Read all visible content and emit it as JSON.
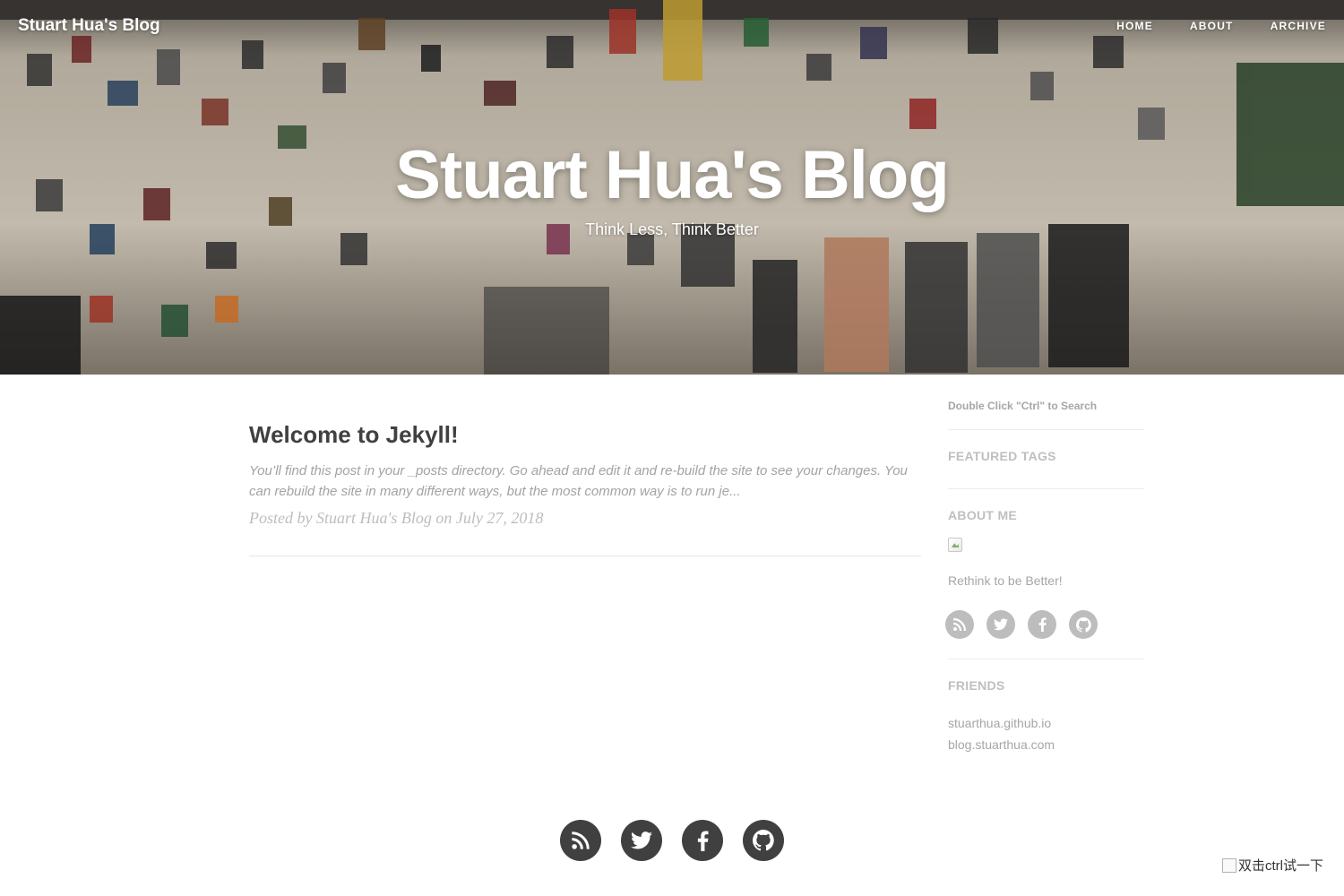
{
  "site": {
    "brand": "Stuart Hua's Blog",
    "nav": [
      {
        "label": "HOME"
      },
      {
        "label": "ABOUT"
      },
      {
        "label": "ARCHIVE"
      }
    ]
  },
  "hero": {
    "title": "Stuart Hua's Blog",
    "subtitle": "Think Less, Think Better"
  },
  "post": {
    "title": "Welcome to Jekyll!",
    "excerpt": "You’ll find this post in your _posts directory. Go ahead and edit it and re-build the site to see your changes. You can rebuild the site in many different ways, but the most common way is to run je...",
    "meta": "Posted by Stuart Hua's Blog on July 27, 2018"
  },
  "sidebar": {
    "search_hint": "Double Click \"Ctrl\" to Search",
    "featured_tags_heading": "FEATURED TAGS",
    "about_heading": "ABOUT ME",
    "about_text": "Rethink to be Better!",
    "social_icons": [
      "rss-icon",
      "twitter-icon",
      "facebook-icon",
      "github-icon"
    ],
    "friends_heading": "FRIENDS",
    "friends": [
      {
        "label": "stuarthua.github.io"
      },
      {
        "label": "blog.stuarthua.com"
      }
    ]
  },
  "footer": {
    "social_icons": [
      "rss-icon",
      "twitter-icon",
      "facebook-icon",
      "github-icon"
    ]
  },
  "corner_badge": {
    "alt_text": "双击ctrl试一下"
  },
  "colors": {
    "text_dark": "#404040",
    "text_muted": "#a6a6a6",
    "sidebar_icon": "#bdbdbd",
    "footer_icon": "#404040"
  }
}
